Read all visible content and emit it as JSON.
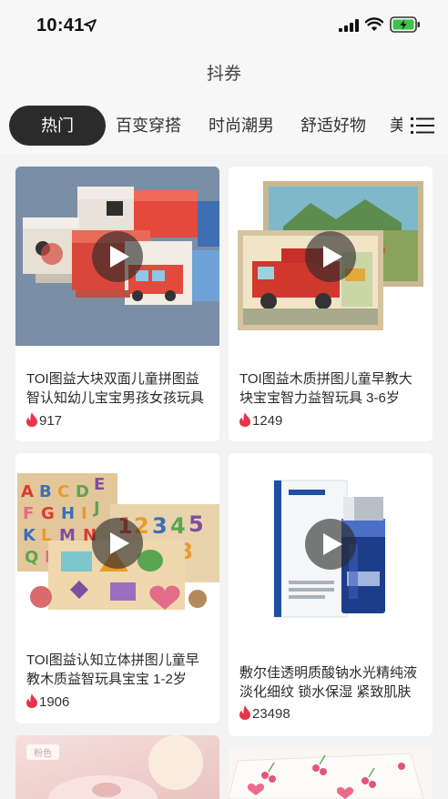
{
  "status_bar": {
    "time": "10:41"
  },
  "header": {
    "title": "抖券"
  },
  "tabs": [
    {
      "label": "热门",
      "active": true
    },
    {
      "label": "百变穿搭",
      "active": false
    },
    {
      "label": "时尚潮男",
      "active": false
    },
    {
      "label": "舒适好物",
      "active": false
    },
    {
      "label": "美",
      "active": false
    }
  ],
  "products": [
    {
      "title": "TOI图益大块双面儿童拼图益智认知幼儿宝宝男孩女孩玩具",
      "likes": "917"
    },
    {
      "title": "TOI图益木质拼图儿童早教大块宝宝智力益智玩具 3-6岁",
      "likes": "1249"
    },
    {
      "title": "TOI图益认知立体拼图儿童早教木质益智玩具宝宝 1-2岁",
      "likes": "1906"
    },
    {
      "title": "敷尔佳透明质酸钠水光精纯液 淡化细纹 锁水保湿 紧致肌肤",
      "likes": "23498"
    },
    {
      "tag": "粉色"
    }
  ],
  "colors": {
    "active_tab_bg": "#2b2b2b",
    "flame": "#e8334a",
    "page_bg": "#f3f3f3"
  },
  "icons": [
    "location-arrow-icon",
    "signal-icon",
    "wifi-icon",
    "battery-charging-icon",
    "menu-list-icon",
    "play-icon",
    "flame-icon"
  ]
}
